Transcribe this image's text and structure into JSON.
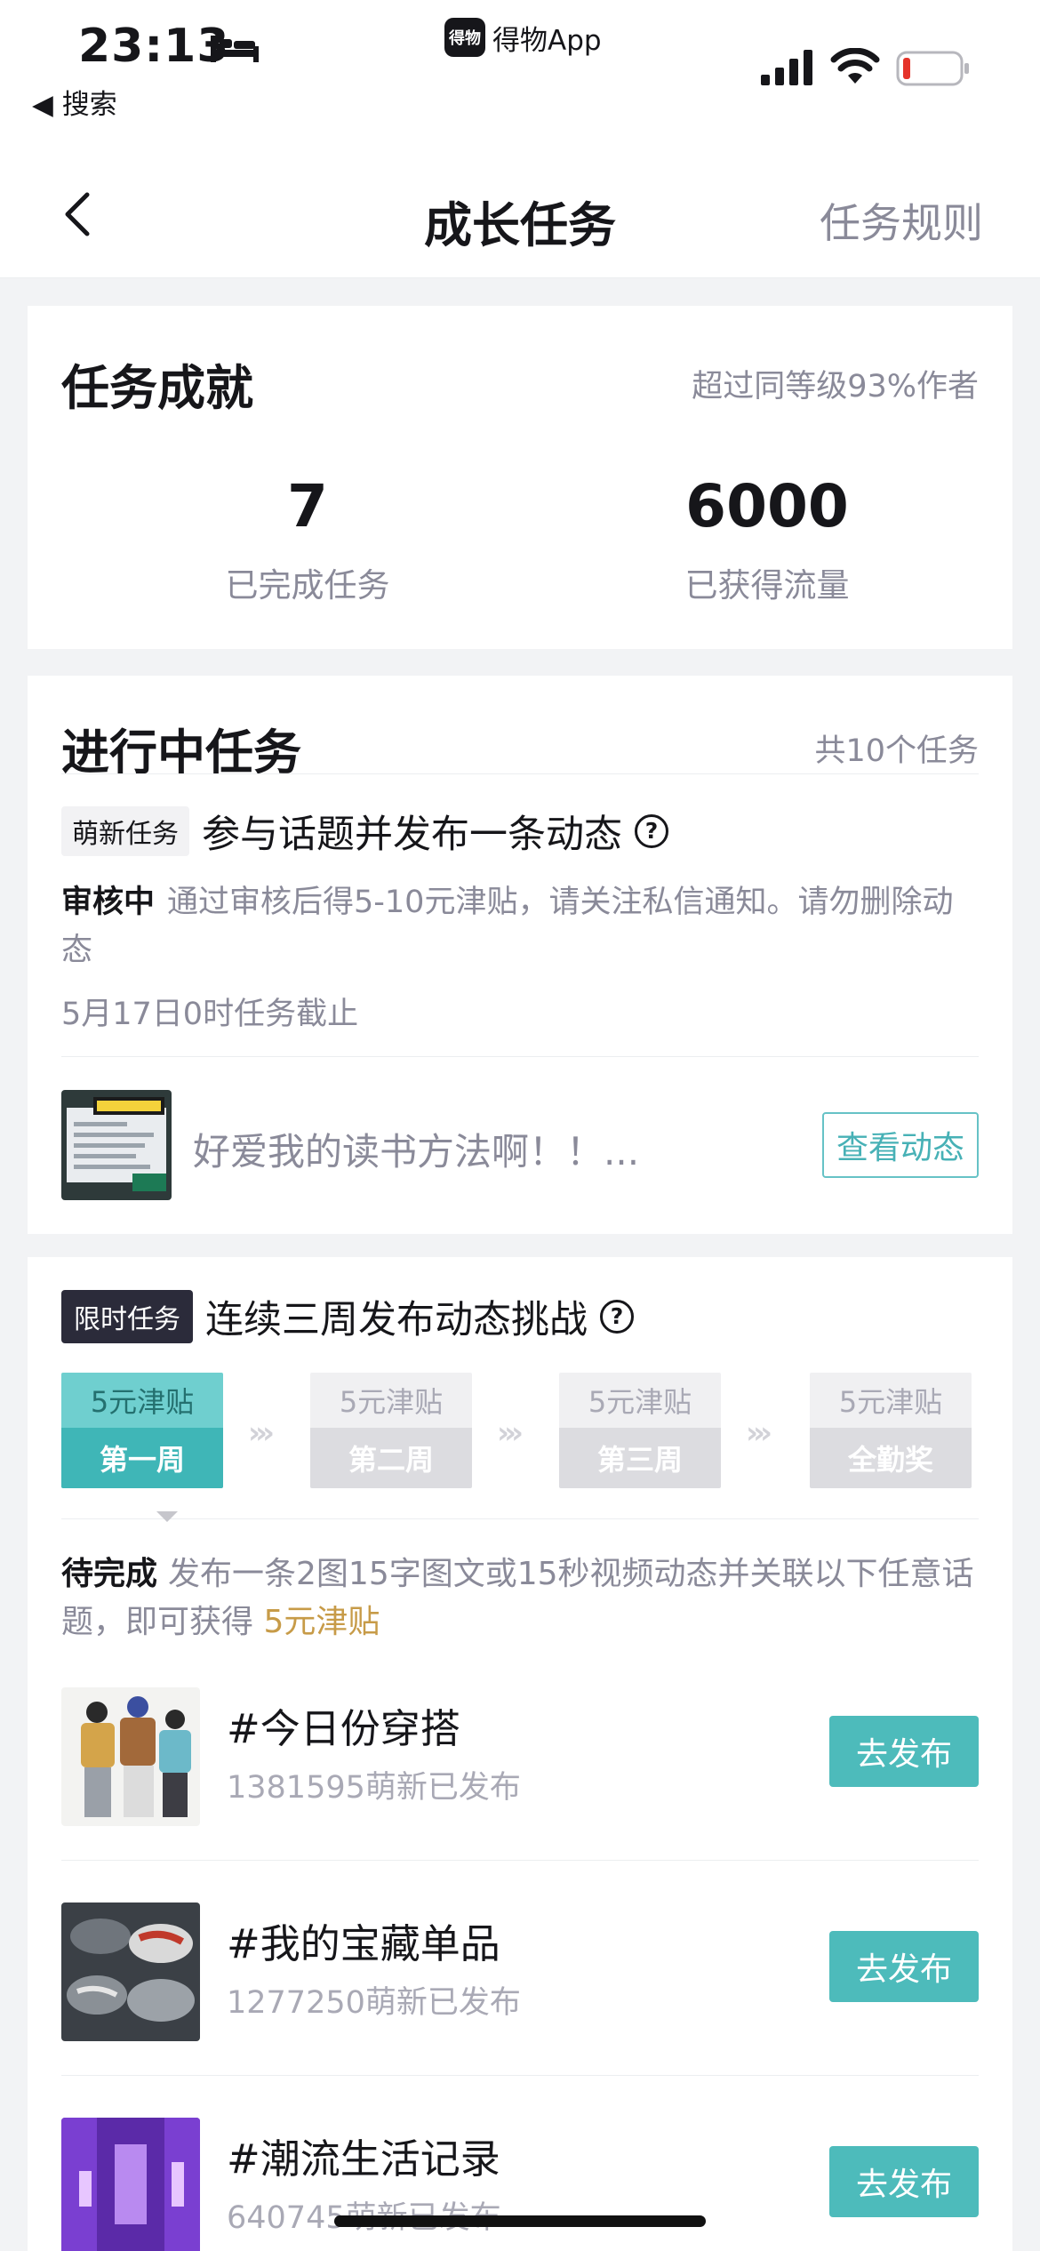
{
  "status_bar": {
    "time": "23:13",
    "back_label": "◀ 搜索",
    "app_name": "得物App",
    "app_logo_text": "得物"
  },
  "nav": {
    "title": "成长任务",
    "rule_link": "任务规则"
  },
  "achievement": {
    "title": "任务成就",
    "rank_text": "超过同等级93%作者",
    "stats": [
      {
        "value": "7",
        "label": "已完成任务"
      },
      {
        "value": "6000",
        "label": "已获得流量"
      }
    ]
  },
  "in_progress": {
    "title": "进行中任务",
    "total_text": "共10个任务",
    "task": {
      "tag": "萌新任务",
      "name": "参与话题并发布一条动态",
      "status_label": "审核中",
      "status_desc": "通过审核后得5-10元津贴，请关注私信通知。请勿删除动态",
      "deadline": "5月17日0时任务截止",
      "post_text": "好爱我的读书方法啊！！...",
      "view_button": "查看动态"
    }
  },
  "limited": {
    "tag": "限时任务",
    "name": "连续三周发布动态挑战",
    "weeks": [
      {
        "reward": "5元津贴",
        "label": "第一周",
        "active": true
      },
      {
        "reward": "5元津贴",
        "label": "第二周",
        "active": false
      },
      {
        "reward": "5元津贴",
        "label": "第三周",
        "active": false
      },
      {
        "reward": "5元津贴",
        "label": "全勤奖",
        "active": false
      }
    ],
    "pending_label": "待完成",
    "pending_desc": "发布一条2图15字图文或15秒视频动态并关联以下任意话题，即可获得",
    "pending_reward": "5元津贴",
    "topics": [
      {
        "name": "#今日份穿搭",
        "count": "1381595萌新已发布",
        "button": "去发布"
      },
      {
        "name": "#我的宝藏单品",
        "count": "1277250萌新已发布",
        "button": "去发布"
      },
      {
        "name": "#潮流生活记录",
        "count": "640745萌新已发布",
        "button": "去发布"
      }
    ]
  },
  "colors": {
    "accent": "#4dbbbb",
    "gold": "#c79b48",
    "muted": "#8a8a99",
    "background": "#f2f3f5"
  }
}
